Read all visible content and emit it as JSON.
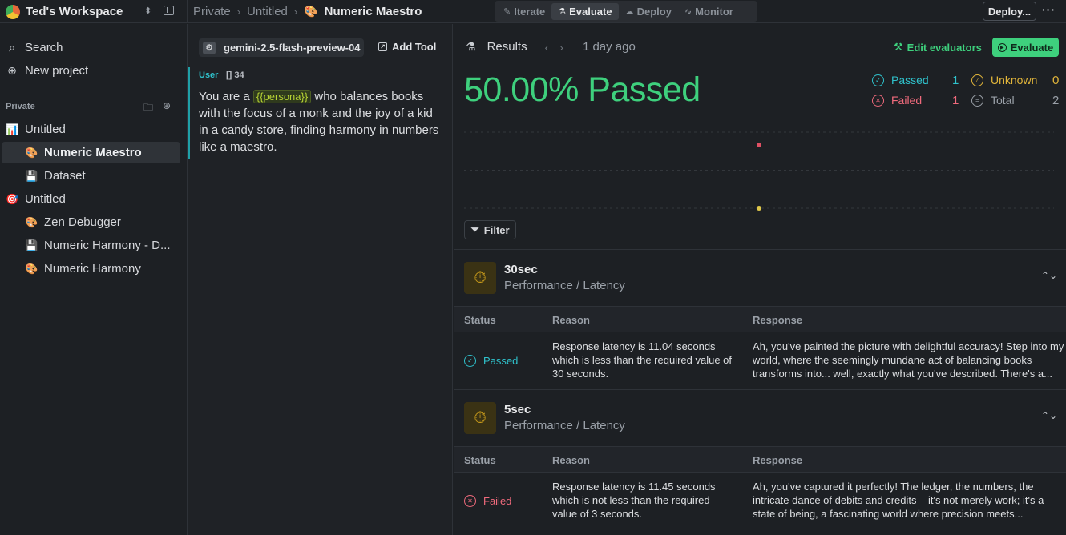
{
  "workspace": {
    "name": "Ted's Workspace"
  },
  "breadcrumb": {
    "items": [
      "Private",
      "Untitled"
    ],
    "current": "Numeric Maestro"
  },
  "modes": [
    {
      "label": "Iterate",
      "active": false
    },
    {
      "label": "Evaluate",
      "active": true
    },
    {
      "label": "Deploy",
      "active": false
    },
    {
      "label": "Monitor",
      "active": false
    }
  ],
  "toolbar": {
    "deploy_label": "Deploy...",
    "more_label": "···"
  },
  "sidebar": {
    "search_label": "Search",
    "new_project_label": "New project",
    "section_label": "Private",
    "items": [
      {
        "label": "Untitled",
        "icon": "chart-icon",
        "level": 0
      },
      {
        "label": "Numeric Maestro",
        "icon": "palette-icon",
        "level": 1,
        "selected": true
      },
      {
        "label": "Dataset",
        "icon": "floppy-icon",
        "level": 1
      },
      {
        "label": "Untitled",
        "icon": "target-icon",
        "level": 0
      },
      {
        "label": "Zen Debugger",
        "icon": "palette-icon",
        "level": 1
      },
      {
        "label": "Numeric Harmony - D...",
        "icon": "floppy-icon",
        "level": 1
      },
      {
        "label": "Numeric Harmony",
        "icon": "palette-icon",
        "level": 1
      }
    ]
  },
  "prompt": {
    "model": "gemini-2.5-flash-preview-04",
    "add_tool_label": "Add Tool",
    "role": "User",
    "token_count": "34",
    "text_before": "You are a",
    "variable": "{{persona}}",
    "text_after": "who balances books with the focus of a monk and the joy of a kid in a candy store, finding harmony in numbers like a maestro."
  },
  "results": {
    "title": "Results",
    "time": "1 day ago",
    "edit_evaluators_label": "Edit evaluators",
    "evaluate_label": "Evaluate",
    "headline": "50.00% Passed",
    "stats": {
      "passed_label": "Passed",
      "passed": "1",
      "failed_label": "Failed",
      "failed": "1",
      "unknown_label": "Unknown",
      "unknown": "0",
      "total_label": "Total",
      "total": "2"
    },
    "filter_label": "Filter",
    "columns": {
      "status": "Status",
      "reason": "Reason",
      "response": "Response"
    },
    "evaluators": [
      {
        "name": "30sec",
        "category": "Performance / Latency",
        "status": "Passed",
        "reason": "Response latency is 11.04 seconds which is less than the required value of 30 seconds.",
        "response": "Ah, you've painted the picture with delightful accuracy! Step into my world, where the seemingly mundane act of balancing books transforms into... well, exactly what you've described. There's a..."
      },
      {
        "name": "5sec",
        "category": "Performance / Latency",
        "status": "Failed",
        "reason": "Response latency is 11.45 seconds which is not less than the required value of 3 seconds.",
        "response": "Ah, you've captured it perfectly! The ledger, the numbers, the intricate dance of debits and credits – it's not merely work; it's a state of being, a fascinating world where precision meets..."
      }
    ]
  },
  "colors": {
    "accent_green": "#3ed07d",
    "passed": "#2fc2cc",
    "failed": "#f06a7c",
    "unknown": "#e0b43a"
  },
  "chart_data": {
    "type": "scatter",
    "series": [
      {
        "color": "#e05064",
        "points": [
          {
            "x": 1,
            "y": 1
          }
        ]
      },
      {
        "color": "#e0c84a",
        "points": [
          {
            "x": 1,
            "y": 0
          }
        ]
      }
    ],
    "grid": true
  }
}
